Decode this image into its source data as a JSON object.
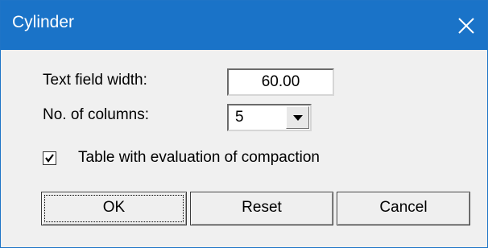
{
  "window": {
    "title": "Cylinder",
    "close_icon": "close-icon"
  },
  "form": {
    "text_field_width_label": "Text field width:",
    "text_field_width_value": "60.00",
    "columns_label": "No. of columns:",
    "columns_value": "5",
    "checkbox_label": "Table with evaluation of compaction",
    "checkbox_checked": true
  },
  "buttons": {
    "ok": "OK",
    "reset": "Reset",
    "cancel": "Cancel"
  },
  "colors": {
    "titlebar": "#1a73c8",
    "dialog_bg": "#f0f0f0"
  }
}
